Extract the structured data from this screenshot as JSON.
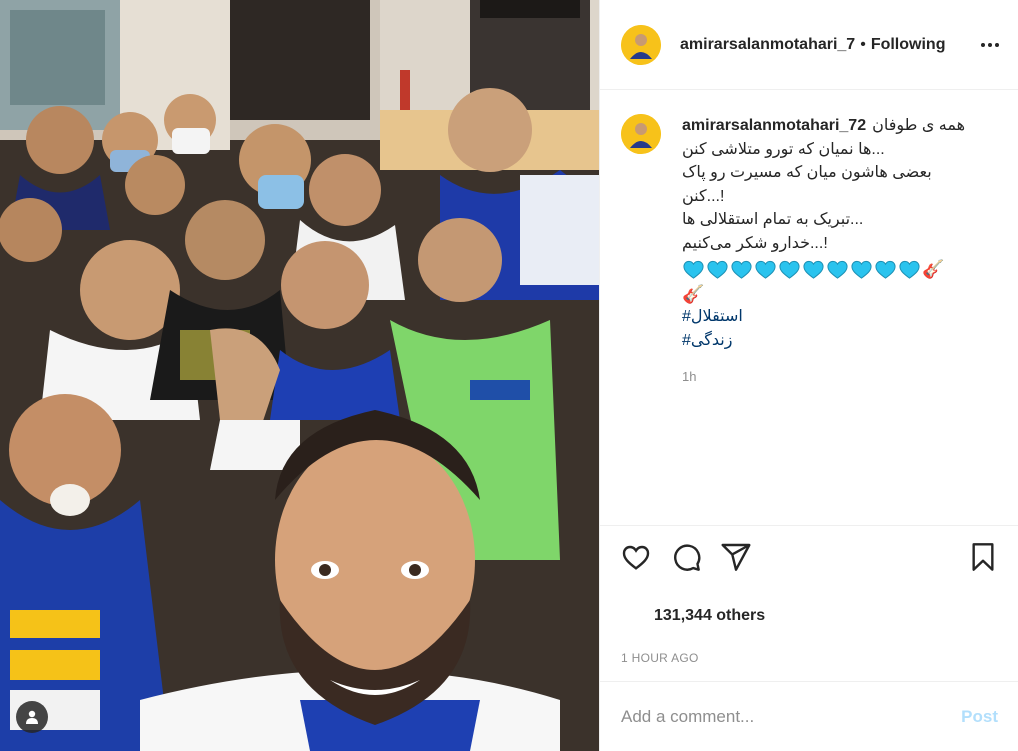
{
  "post": {
    "author": {
      "username": "amirarsalanmotahari_7",
      "avatar_icon": "profile-avatar",
      "follow_status": "Following",
      "separator": "•"
    },
    "more_options_icon": "more-horizontal-icon",
    "photo": {
      "description_icon": "team-selfie-photo",
      "user_tag_icon": "user-tag-icon"
    },
    "caption": {
      "username": "amirarsalanmotahari_72",
      "lines": [
        "همه ی طوفان",
        "...ها نمیان که تورو متلاشی کنن",
        "بعضی هاشون میان که مسیرت رو پاک",
        "!...کنن",
        "...تبریک به تمام استقلالی ها",
        "!...خدارو شکر می‌کنیم"
      ],
      "heart_emoji_count": 10,
      "heart_color": "#2ac3ee",
      "guitar_emoji": "🎸",
      "hashtags": [
        "#استقلال",
        "#زندگی"
      ],
      "time": "1h"
    },
    "actions": {
      "like_icon": "heart-outline-icon",
      "comment_icon": "comment-bubble-icon",
      "share_icon": "paper-plane-icon",
      "save_icon": "bookmark-icon"
    },
    "likes_text": "131,344 others",
    "timestamp": "1 HOUR AGO",
    "comment_input": {
      "placeholder": "Add a comment...",
      "post_label": "Post",
      "post_color": "#b2dffc"
    }
  }
}
